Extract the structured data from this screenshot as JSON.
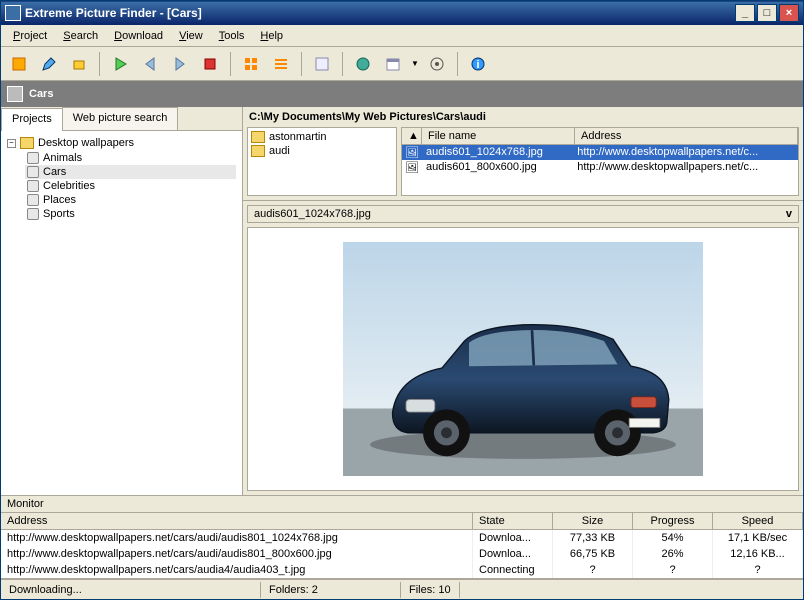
{
  "window": {
    "title": "Extreme Picture Finder - [Cars]",
    "minimize": "_",
    "maximize": "□",
    "close": "×"
  },
  "menu": [
    "Project",
    "Search",
    "Download",
    "View",
    "Tools",
    "Help"
  ],
  "tabbar": {
    "label": "Cars"
  },
  "left": {
    "tabs": {
      "projects": "Projects",
      "web": "Web picture search"
    },
    "root": "Desktop wallpapers",
    "items": [
      "Animals",
      "Cars",
      "Celebrities",
      "Places",
      "Sports"
    ],
    "selected": "Cars"
  },
  "browser": {
    "path": "C:\\My Documents\\My Web Pictures\\Cars\\audi",
    "folders": [
      "astonmartin",
      "audi"
    ],
    "columns": {
      "sort": "▲",
      "filename": "File name",
      "address": "Address"
    },
    "files": [
      {
        "icon": "🖼",
        "name": "audis601_1024x768.jpg",
        "addr": "http://www.desktopwallpapers.net/c..."
      },
      {
        "icon": "🖼",
        "name": "audis601_800x600.jpg",
        "addr": "http://www.desktopwallpapers.net/c..."
      }
    ],
    "preview_name": "audis601_1024x768.jpg",
    "chev": "v"
  },
  "monitor": {
    "title": "Monitor",
    "columns": {
      "address": "Address",
      "state": "State",
      "size": "Size",
      "progress": "Progress",
      "speed": "Speed"
    },
    "rows": [
      {
        "addr": "http://www.desktopwallpapers.net/cars/audi/audis801_1024x768.jpg",
        "state": "Downloa...",
        "size": "77,33 KB",
        "prog": "54%",
        "speed": "17,1 KB/sec"
      },
      {
        "addr": "http://www.desktopwallpapers.net/cars/audi/audis801_800x600.jpg",
        "state": "Downloa...",
        "size": "66,75 KB",
        "prog": "26%",
        "speed": "12,16 KB..."
      },
      {
        "addr": "http://www.desktopwallpapers.net/cars/audia4/audia403_t.jpg",
        "state": "Connecting",
        "size": "?",
        "prog": "?",
        "speed": "?"
      }
    ]
  },
  "status": {
    "downloading": "Downloading...",
    "folders": "Folders: 2",
    "files": "Files: 10"
  }
}
